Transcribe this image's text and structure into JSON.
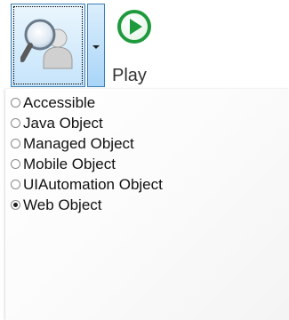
{
  "toolbar": {
    "spy_icon": "magnifier-person-icon",
    "dropdown_icon": "chevron-down-icon",
    "play_icon": "play-circle-icon",
    "play_label": "Play",
    "accent_color": "#1e9a3c",
    "highlight_color": "#c6e4fb"
  },
  "menu": {
    "items": [
      {
        "label": "Accessible",
        "checked": false
      },
      {
        "label": "Java Object",
        "checked": false
      },
      {
        "label": "Managed Object",
        "checked": false
      },
      {
        "label": "Mobile Object",
        "checked": false
      },
      {
        "label": "UIAutomation Object",
        "checked": false
      },
      {
        "label": "Web Object",
        "checked": true
      }
    ]
  }
}
